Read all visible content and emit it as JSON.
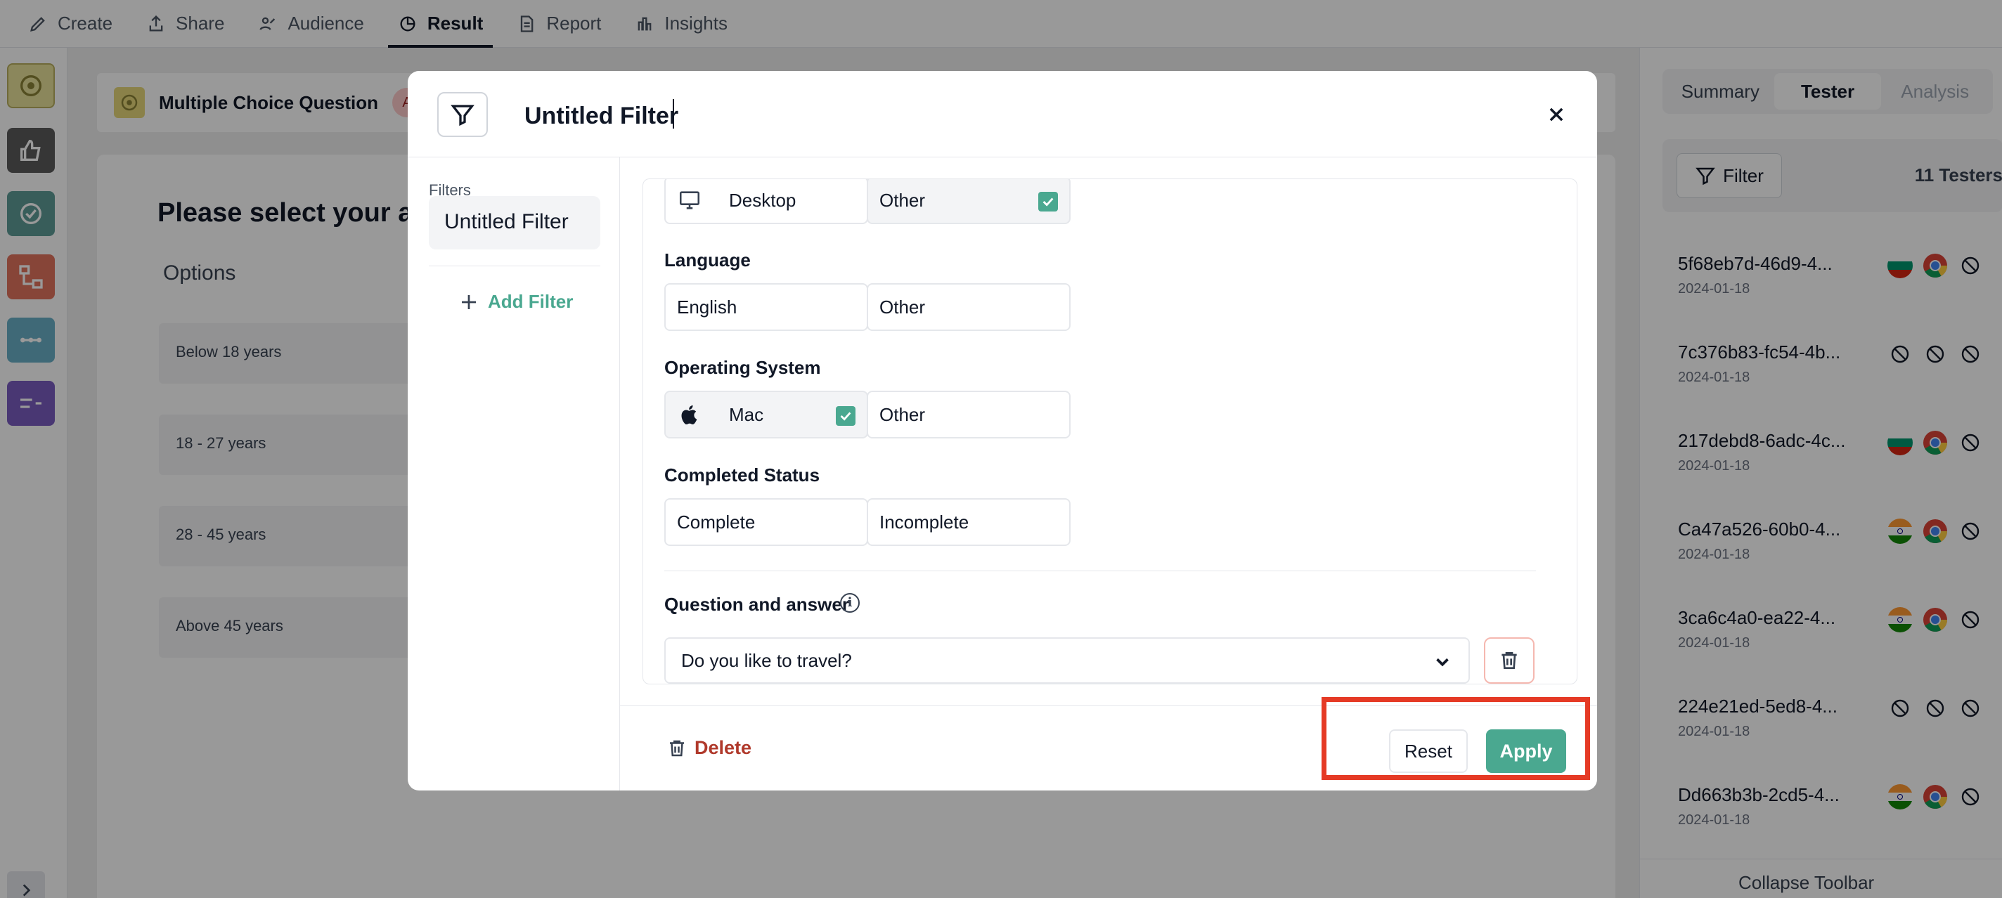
{
  "topnav": {
    "items": [
      {
        "label": "Create",
        "icon": "pencil-icon"
      },
      {
        "label": "Share",
        "icon": "share-icon"
      },
      {
        "label": "Audience",
        "icon": "audience-icon"
      },
      {
        "label": "Result",
        "icon": "chart-pie-icon",
        "active": true
      },
      {
        "label": "Report",
        "icon": "document-icon"
      },
      {
        "label": "Insights",
        "icon": "bar-chart-icon"
      }
    ]
  },
  "question": {
    "header_title": "Multiple Choice Question",
    "avatar": "A",
    "text": "Please select your ag",
    "options_label": "Options",
    "options": [
      "Below 18 years",
      "18 - 27 years",
      "28 - 45 years",
      "Above 45 years"
    ]
  },
  "right_panel": {
    "tabs": [
      "Summary",
      "Tester",
      "Analysis"
    ],
    "active_tab": "Tester",
    "filter_label": "Filter",
    "tester_count": "11 Testers",
    "testers": [
      {
        "id": "5f68eb7d-46d9-4...",
        "date": "2024-01-18",
        "icons": [
          "flag-bulgaria-icon",
          "chrome-icon",
          "blocked-icon"
        ]
      },
      {
        "id": "7c376b83-fc54-4b...",
        "date": "2024-01-18",
        "icons": [
          "blocked-icon",
          "blocked-icon",
          "blocked-icon"
        ]
      },
      {
        "id": "217debd8-6adc-4c...",
        "date": "2024-01-18",
        "icons": [
          "flag-bulgaria-icon",
          "chrome-icon",
          "blocked-icon"
        ]
      },
      {
        "id": "Ca47a526-60b0-4...",
        "date": "2024-01-18",
        "icons": [
          "flag-india-icon",
          "chrome-icon",
          "blocked-icon"
        ]
      },
      {
        "id": "3ca6c4a0-ea22-4...",
        "date": "2024-01-18",
        "icons": [
          "flag-india-icon",
          "chrome-icon",
          "blocked-icon"
        ]
      },
      {
        "id": "224e21ed-5ed8-4...",
        "date": "2024-01-18",
        "icons": [
          "blocked-icon",
          "blocked-icon",
          "blocked-icon"
        ]
      },
      {
        "id": "Dd663b3b-2cd5-4...",
        "date": "2024-01-18",
        "icons": [
          "flag-india-icon",
          "chrome-icon",
          "blocked-icon"
        ]
      }
    ],
    "collapse_label": "Collapse Toolbar"
  },
  "modal": {
    "title_value": "Untitled Filter",
    "sidebar": {
      "label": "Filters",
      "items": [
        "Untitled Filter"
      ],
      "add_label": "Add Filter"
    },
    "device": {
      "options": [
        {
          "label": "Desktop",
          "icon": "monitor-icon",
          "selected": false
        },
        {
          "label": "Other",
          "selected": true
        }
      ]
    },
    "language": {
      "title": "Language",
      "options": [
        {
          "label": "English",
          "selected": false
        },
        {
          "label": "Other",
          "selected": false
        }
      ]
    },
    "os": {
      "title": "Operating System",
      "options": [
        {
          "label": "Mac",
          "icon": "apple-icon",
          "selected": true
        },
        {
          "label": "Other",
          "selected": false
        }
      ]
    },
    "status": {
      "title": "Completed Status",
      "options": [
        {
          "label": "Complete",
          "selected": false
        },
        {
          "label": "Incomplete",
          "selected": false
        }
      ]
    },
    "qa": {
      "title": "Question and answer",
      "info": "i",
      "selected_question": "Do you like to travel?"
    },
    "footer": {
      "delete_label": "Delete",
      "reset_label": "Reset",
      "apply_label": "Apply"
    }
  },
  "colors": {
    "accent": "#4aa890",
    "danger": "#b0392b",
    "highlight": "#e53a25"
  }
}
